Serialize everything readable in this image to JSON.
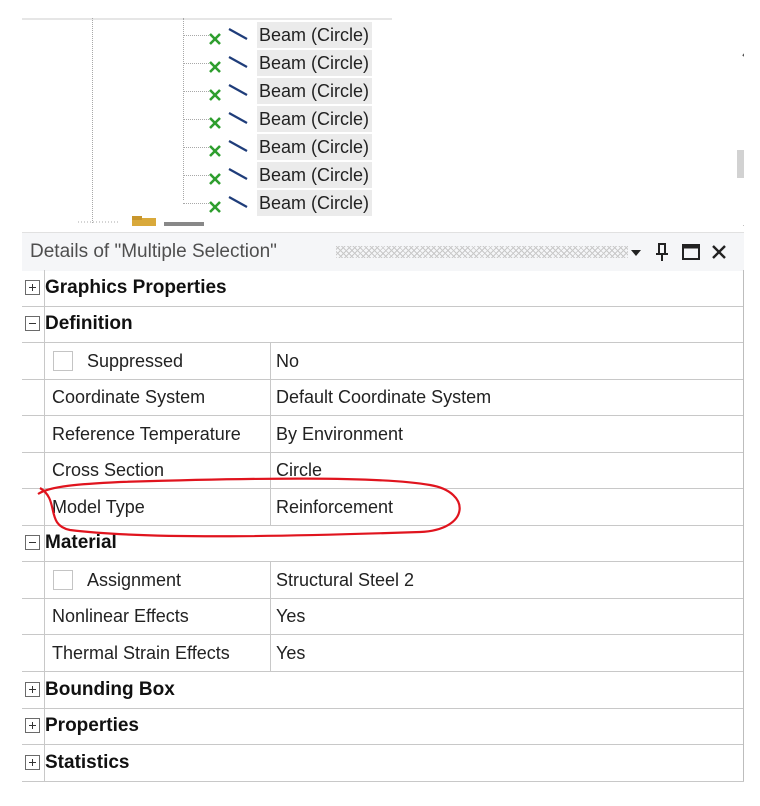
{
  "tree": {
    "items": [
      {
        "label": "Beam (Circle)"
      },
      {
        "label": "Beam (Circle)"
      },
      {
        "label": "Beam (Circle)"
      },
      {
        "label": "Beam (Circle)"
      },
      {
        "label": "Beam (Circle)"
      },
      {
        "label": "Beam (Circle)"
      },
      {
        "label": "Beam (Circle)"
      }
    ]
  },
  "details": {
    "title": "Details of \"Multiple Selection\""
  },
  "grid": {
    "categories": {
      "graphics": "Graphics Properties",
      "definition": "Definition",
      "material": "Material",
      "bounding_box": "Bounding Box",
      "properties": "Properties",
      "statistics": "Statistics"
    },
    "definition": [
      {
        "name": "Suppressed",
        "value": "No"
      },
      {
        "name": "Coordinate System",
        "value": "Default Coordinate System"
      },
      {
        "name": "Reference Temperature",
        "value": "By Environment"
      },
      {
        "name": "Cross Section",
        "value": "Circle"
      },
      {
        "name": "Model Type",
        "value": "Reinforcement"
      }
    ],
    "material": [
      {
        "name": "Assignment",
        "value": "Structural Steel 2"
      },
      {
        "name": "Nonlinear Effects",
        "value": "Yes"
      },
      {
        "name": "Thermal Strain Effects",
        "value": "Yes"
      }
    ]
  },
  "colors": {
    "check_green": "#2e9e2e",
    "beam_blue": "#1f3d7a",
    "annotation_red": "#e0141e",
    "header_bg": "#f5f6f8"
  },
  "icons": [
    "green-check-icon",
    "beam-icon",
    "chevron-up-icon",
    "chevron-down-icon",
    "dropdown-arrow-icon",
    "pin-icon",
    "maximize-icon",
    "close-icon",
    "expand-icon",
    "collapse-icon",
    "checkbox-icon"
  ]
}
